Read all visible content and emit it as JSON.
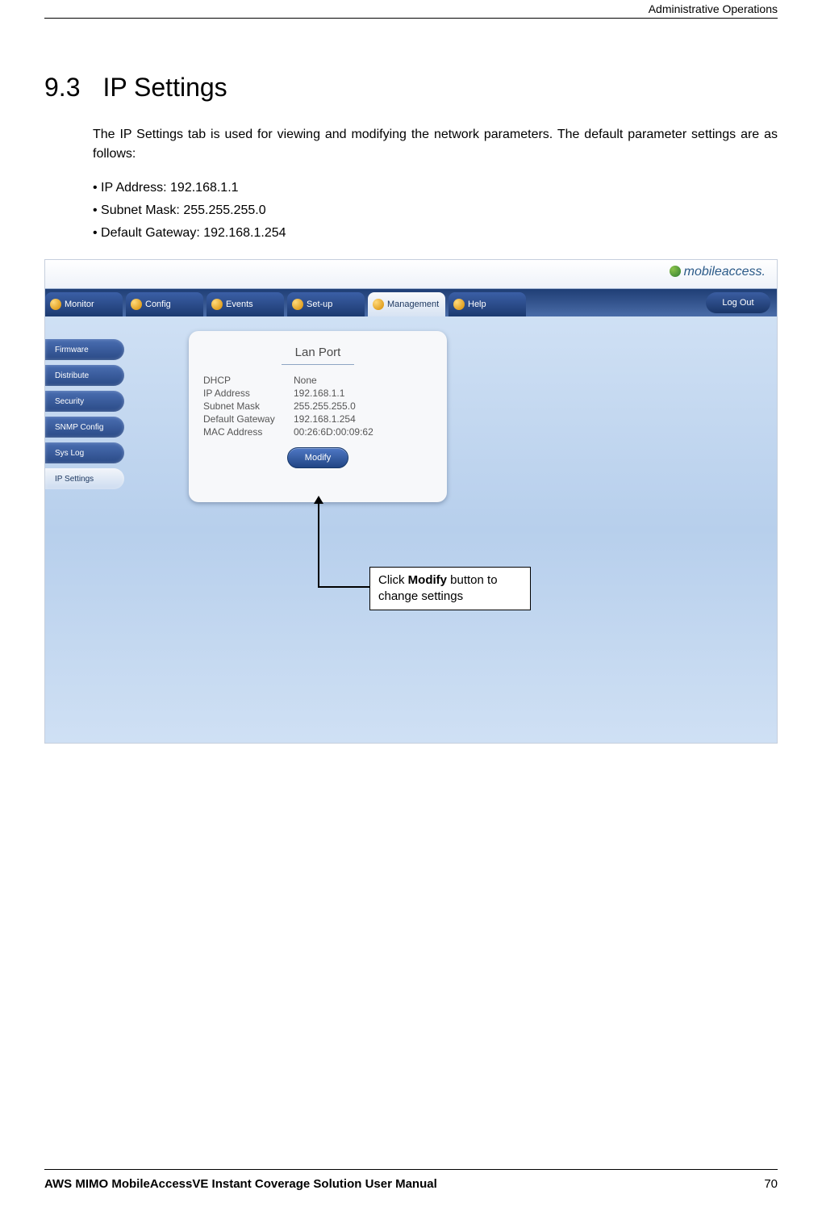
{
  "header": {
    "breadcrumb": "Administrative Operations"
  },
  "section": {
    "number": "9.3",
    "title": "IP Settings"
  },
  "intro": "The IP Settings tab is used for viewing and modifying the network parameters. The default parameter settings are as follows:",
  "defaults": [
    "IP Address: 192.168.1.1",
    "Subnet Mask: 255.255.255.0",
    "Default Gateway: 192.168.1.254"
  ],
  "screenshot": {
    "brand": "mobileaccess.",
    "tabs": [
      {
        "label": "Monitor",
        "active": false
      },
      {
        "label": "Config",
        "active": false
      },
      {
        "label": "Events",
        "active": false
      },
      {
        "label": "Set-up",
        "active": false
      },
      {
        "label": "Management",
        "active": true
      },
      {
        "label": "Help",
        "active": false
      }
    ],
    "logout": "Log Out",
    "sidebar": [
      {
        "label": "Firmware",
        "active": false
      },
      {
        "label": "Distribute",
        "active": false
      },
      {
        "label": "Security",
        "active": false
      },
      {
        "label": "SNMP Config",
        "active": false
      },
      {
        "label": "Sys Log",
        "active": false
      },
      {
        "label": "IP Settings",
        "active": true
      }
    ],
    "panel": {
      "title": "Lan Port",
      "rows": [
        {
          "k": "DHCP",
          "v": "None"
        },
        {
          "k": "IP Address",
          "v": "192.168.1.1"
        },
        {
          "k": "Subnet Mask",
          "v": "255.255.255.0"
        },
        {
          "k": "Default Gateway",
          "v": "192.168.1.254"
        },
        {
          "k": "MAC Address",
          "v": "00:26:6D:00:09:62"
        }
      ],
      "modify": "Modify"
    },
    "callout_pre": "Click ",
    "callout_bold": "Modify",
    "callout_post": " button to change settings"
  },
  "footer": {
    "manual": "AWS MIMO MobileAccessVE Instant Coverage Solution User Manual",
    "page": "70"
  }
}
